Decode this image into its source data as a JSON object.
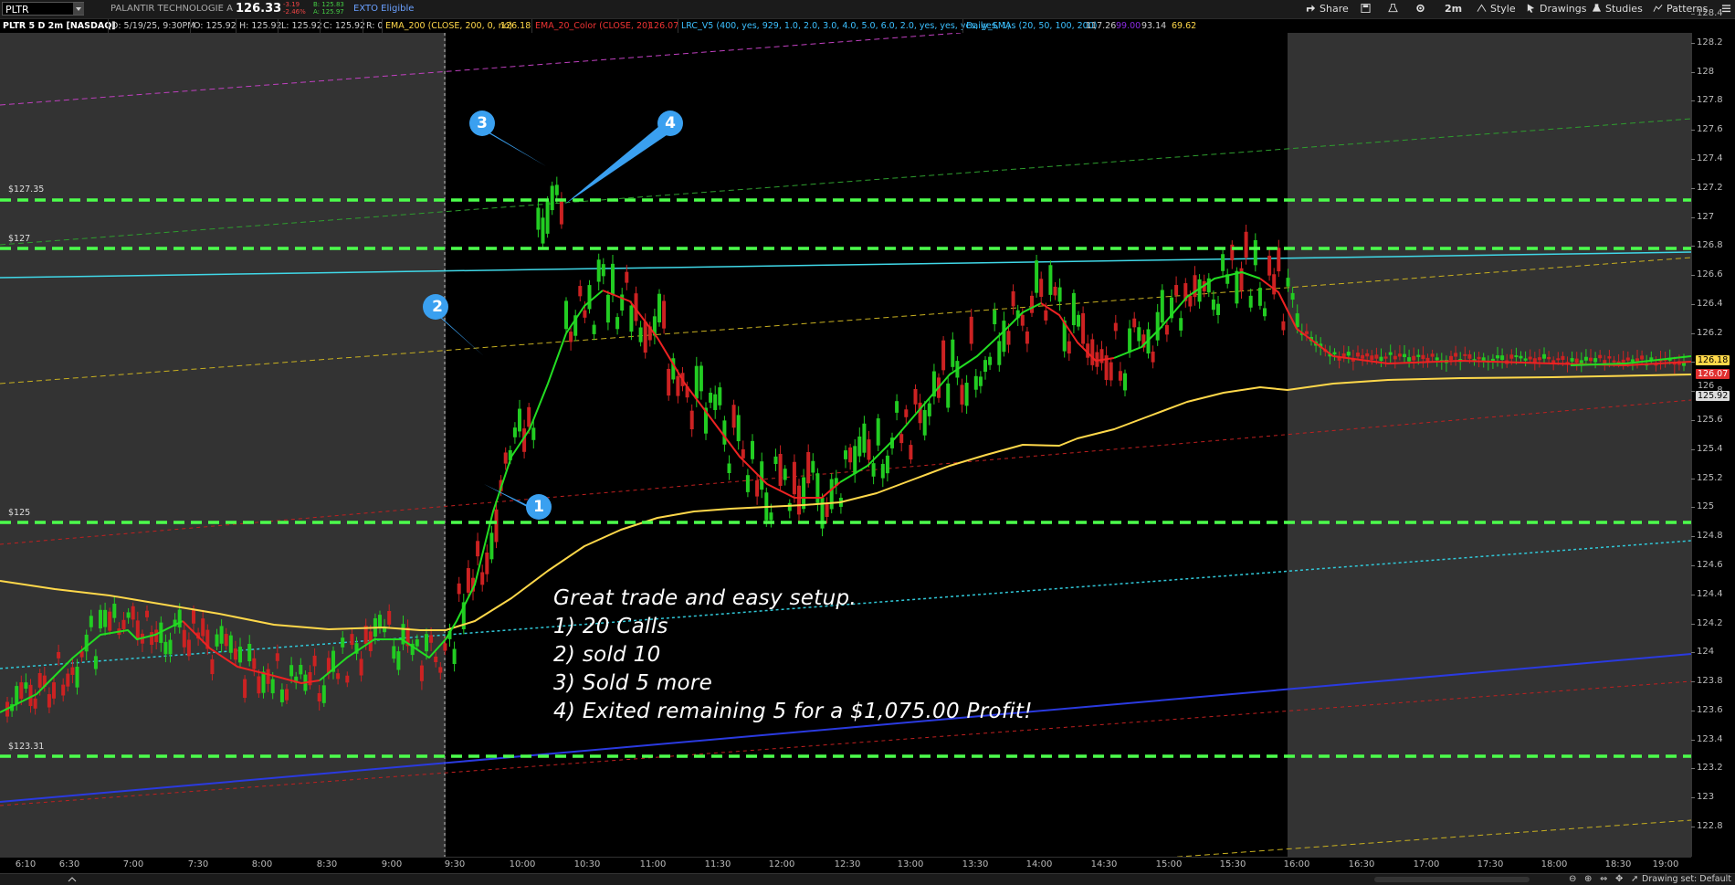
{
  "toolbar": {
    "symbol": "PLTR",
    "company": "PALANTIR TECHNOLOGIE A",
    "last_price": "126.33",
    "change": "-3.19",
    "change_pct": "-2.46%",
    "bid": "B: 125.83",
    "ask": "A: 125.97",
    "exto": "EXTO Eligible",
    "share_label": "Share",
    "timeframe_label": "2m",
    "style_label": "Style",
    "drawings_label": "Drawings",
    "studies_label": "Studies",
    "patterns_label": "Patterns"
  },
  "info_bar": {
    "desc": "PLTR 5 D 2m [NASDAQ]",
    "date": "D: 5/19/25, 9:30PM",
    "open": "O: 125.92",
    "high": "H: 125.92",
    "low": "L: 125.92",
    "close": "C: 125.92",
    "range": "R: 0",
    "ema200_label": "EMA_200 (CLOSE, 200, 0, no)",
    "ema200_value": "126.18",
    "ema20_label": "EMA_20_Color (CLOSE, 20)",
    "ema20_value": "126.07",
    "lrc_label": "LRC_V5 (400, yes, 929, 1.0, 2.0, 3.0, 4.0, 5.0, 6.0, 2.0, yes, yes, yes, yes, 1)",
    "sma_label": "Daily_SMAs (20, 50, 100, 200)",
    "sma20": "117.26",
    "sma50": "99.00",
    "sma100": "93.14",
    "sma200": "69.62"
  },
  "levels": {
    "l1": "$127.35",
    "l2": "$127",
    "l3": "$125",
    "l4": "$123.31"
  },
  "price_axis": {
    "ticks": [
      "128.4",
      "128.2",
      "128",
      "127.8",
      "127.6",
      "127.4",
      "127.2",
      "127",
      "126.8",
      "126.6",
      "126.4",
      "126.2",
      "126",
      "125.8",
      "125.6",
      "125.4",
      "125.2",
      "125",
      "124.8",
      "124.6",
      "124.4",
      "124.2",
      "124",
      "123.8",
      "123.6",
      "123.4",
      "123.2",
      "123",
      "122.8"
    ],
    "badge_ema200": "126.18",
    "badge_ema20": "126.07",
    "badge_last": "125.92",
    "badge_small": "126"
  },
  "time_axis": {
    "ticks": [
      "6:10",
      "6:30",
      "7:00",
      "7:30",
      "8:00",
      "8:30",
      "9:00",
      "9:30",
      "10:00",
      "10:30",
      "11:00",
      "11:30",
      "12:00",
      "12:30",
      "13:00",
      "13:30",
      "14:00",
      "14:30",
      "15:00",
      "15:30",
      "16:00",
      "16:30",
      "17:00",
      "17:30",
      "18:00",
      "18:30",
      "19:00"
    ]
  },
  "markers": {
    "m1": "1",
    "m2": "2",
    "m3": "3",
    "m4": "4"
  },
  "annotation": {
    "line1": "Great trade and easy setup.",
    "line2": "1) 20 Calls",
    "line3": "2) sold 10",
    "line4": "3) Sold 5 more",
    "line5": "4) Exited remaining 5 for a $1,075.00 Profit!"
  },
  "status": {
    "drawing_set": "Drawing set: Default"
  },
  "colors": {
    "level_line": "#4cff4c",
    "ema20_up": "#22dd22",
    "ema20_down": "#ee2222",
    "ema200": "#ffd84a",
    "candle_up": "#22cc22",
    "candle_down": "#cc2222",
    "marker": "#3aa0f0"
  }
}
